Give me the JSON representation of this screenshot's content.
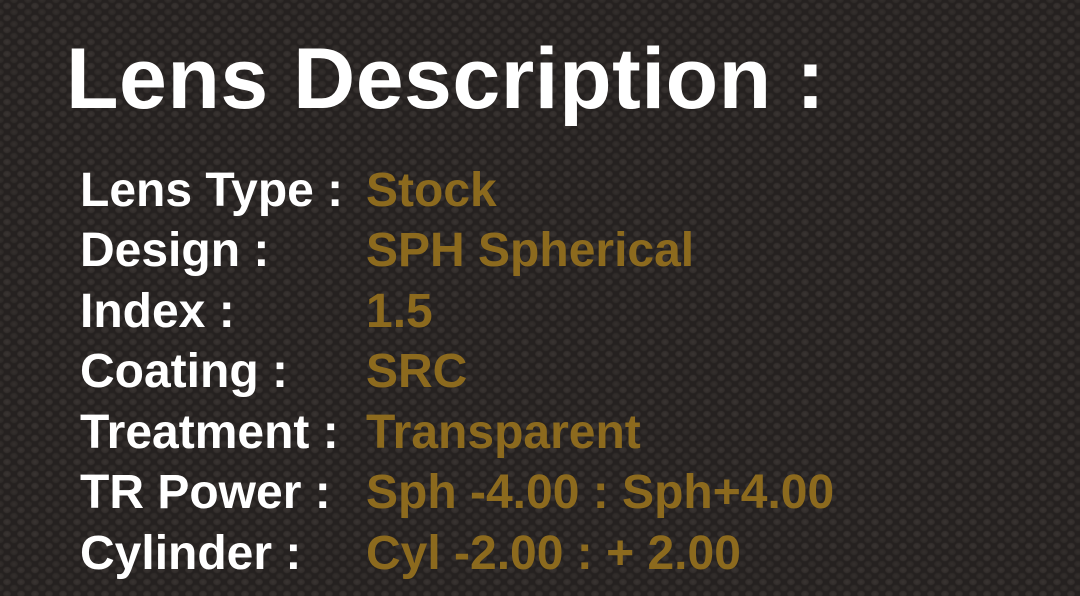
{
  "title": "Lens Description :",
  "specs": [
    {
      "label": "Lens Type :",
      "value": "Stock"
    },
    {
      "label": "Design :",
      "value": "SPH Spherical"
    },
    {
      "label": "Index :",
      "value": "1.5"
    },
    {
      "label": "Coating :",
      "value": "SRC"
    },
    {
      "label": "Treatment :",
      "value": "Transparent"
    },
    {
      "label": "TR Power :",
      "value": "Sph -4.00 : Sph+4.00"
    },
    {
      "label": "Cylinder :",
      "value": "Cyl -2.00 : + 2.00"
    }
  ],
  "colors": {
    "label": "#ffffff",
    "value": "#8c6a1e",
    "background": "#252120"
  }
}
